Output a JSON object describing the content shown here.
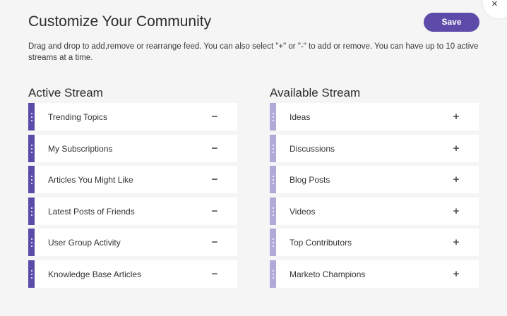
{
  "header": {
    "title": "Customize Your Community",
    "save_label": "Save",
    "close_glyph": "×"
  },
  "description": "Drag and drop to add,remove or rearrange feed. You can also select \"+\" or \"-\" to add or remove. You can have up to 10 active streams at a time.",
  "active_stream": {
    "title": "Active Stream",
    "action_glyph": "−",
    "items": [
      {
        "label": "Trending Topics"
      },
      {
        "label": "My Subscriptions"
      },
      {
        "label": "Articles You Might Like"
      },
      {
        "label": "Latest Posts of Friends"
      },
      {
        "label": "User Group Activity"
      },
      {
        "label": "Knowledge Base Articles"
      }
    ]
  },
  "available_stream": {
    "title": "Available Stream",
    "action_glyph": "+",
    "items": [
      {
        "label": "Ideas"
      },
      {
        "label": "Discussions"
      },
      {
        "label": "Blog Posts"
      },
      {
        "label": "Videos"
      },
      {
        "label": "Top Contributors"
      },
      {
        "label": "Marketo Champions"
      }
    ]
  },
  "colors": {
    "accent": "#5c4ba8",
    "accent_light": "#b3a9d8",
    "background": "#f5f5f5",
    "row_background": "#ffffff"
  },
  "icons": {
    "close": "close-icon",
    "drag_handle": "drag-handle-icon",
    "remove": "minus-icon",
    "add": "plus-icon"
  }
}
